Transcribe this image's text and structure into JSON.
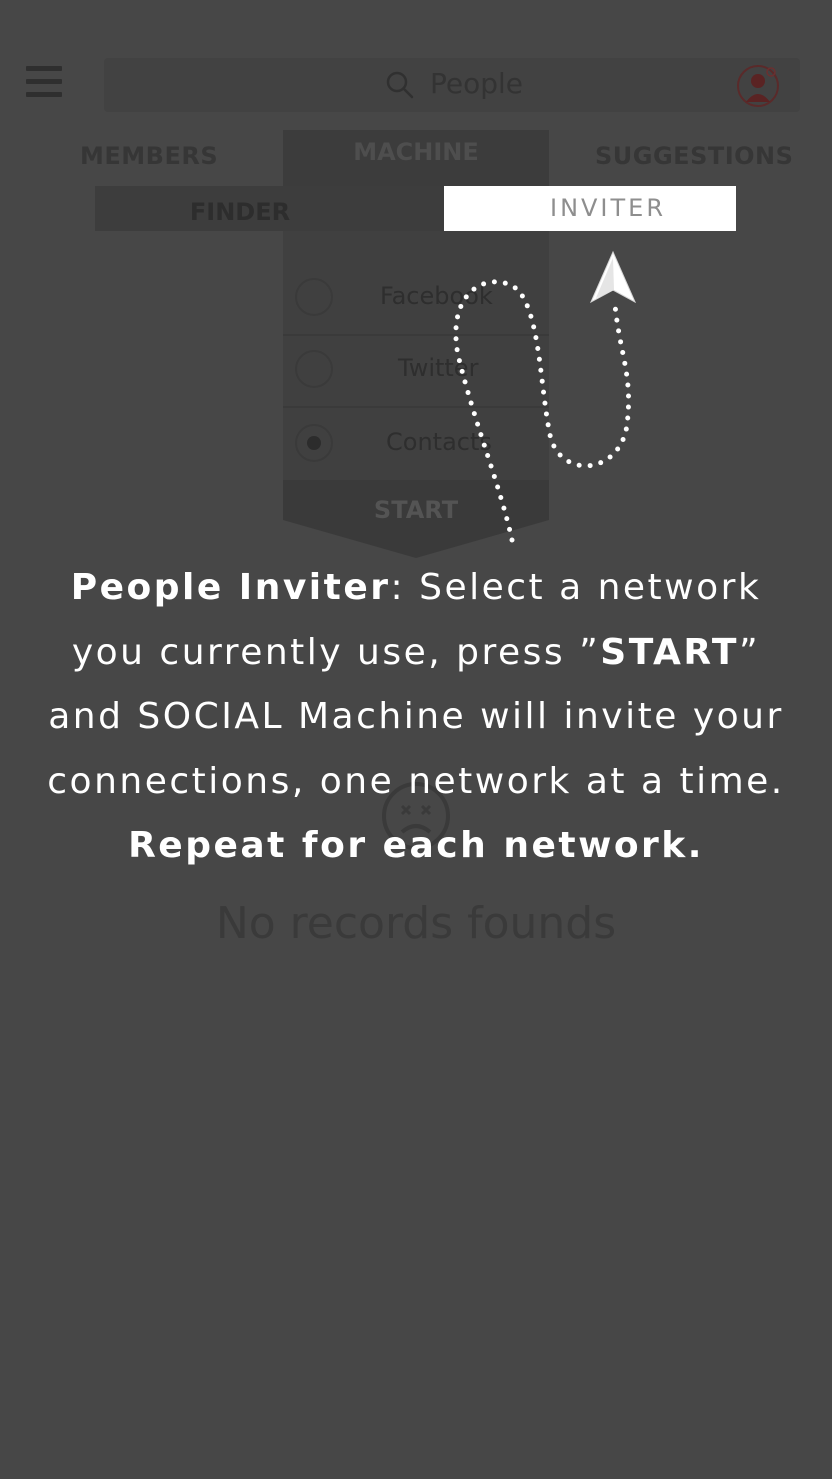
{
  "header": {
    "menu_icon": "hamburger-menu-icon",
    "search_placeholder": "People",
    "search_icon": "search-icon",
    "avatar_icon": "user-avatar-icon"
  },
  "tabs": {
    "members": "MEMBERS",
    "machine": "MACHINE",
    "suggestions": "SUGGESTIONS"
  },
  "sub_tabs": {
    "finder": "FINDER",
    "inviter": "INVITER"
  },
  "networks": [
    {
      "label": "Facebook",
      "selected": false
    },
    {
      "label": "Twitter",
      "selected": false
    },
    {
      "label": "Contacts",
      "selected": true
    }
  ],
  "start_label": "START",
  "empty_state": {
    "icon": "sad-face-icon",
    "text": "No records founds"
  },
  "tutorial": {
    "title": "People Inviter",
    "part1": ": Select a network you currently use, press ”",
    "start_word": "START",
    "part2": "” and SOCIAL Machine will invite your connections, one network at a time. ",
    "emphasis": "Repeat for each network.",
    "pointer_icon": "arrow-pointer-icon"
  },
  "colors": {
    "overlay_bg": "#474747",
    "highlight": "#ffffff",
    "inviter_text": "#8e8e8e",
    "avatar_accent": "#8a2b2b"
  }
}
